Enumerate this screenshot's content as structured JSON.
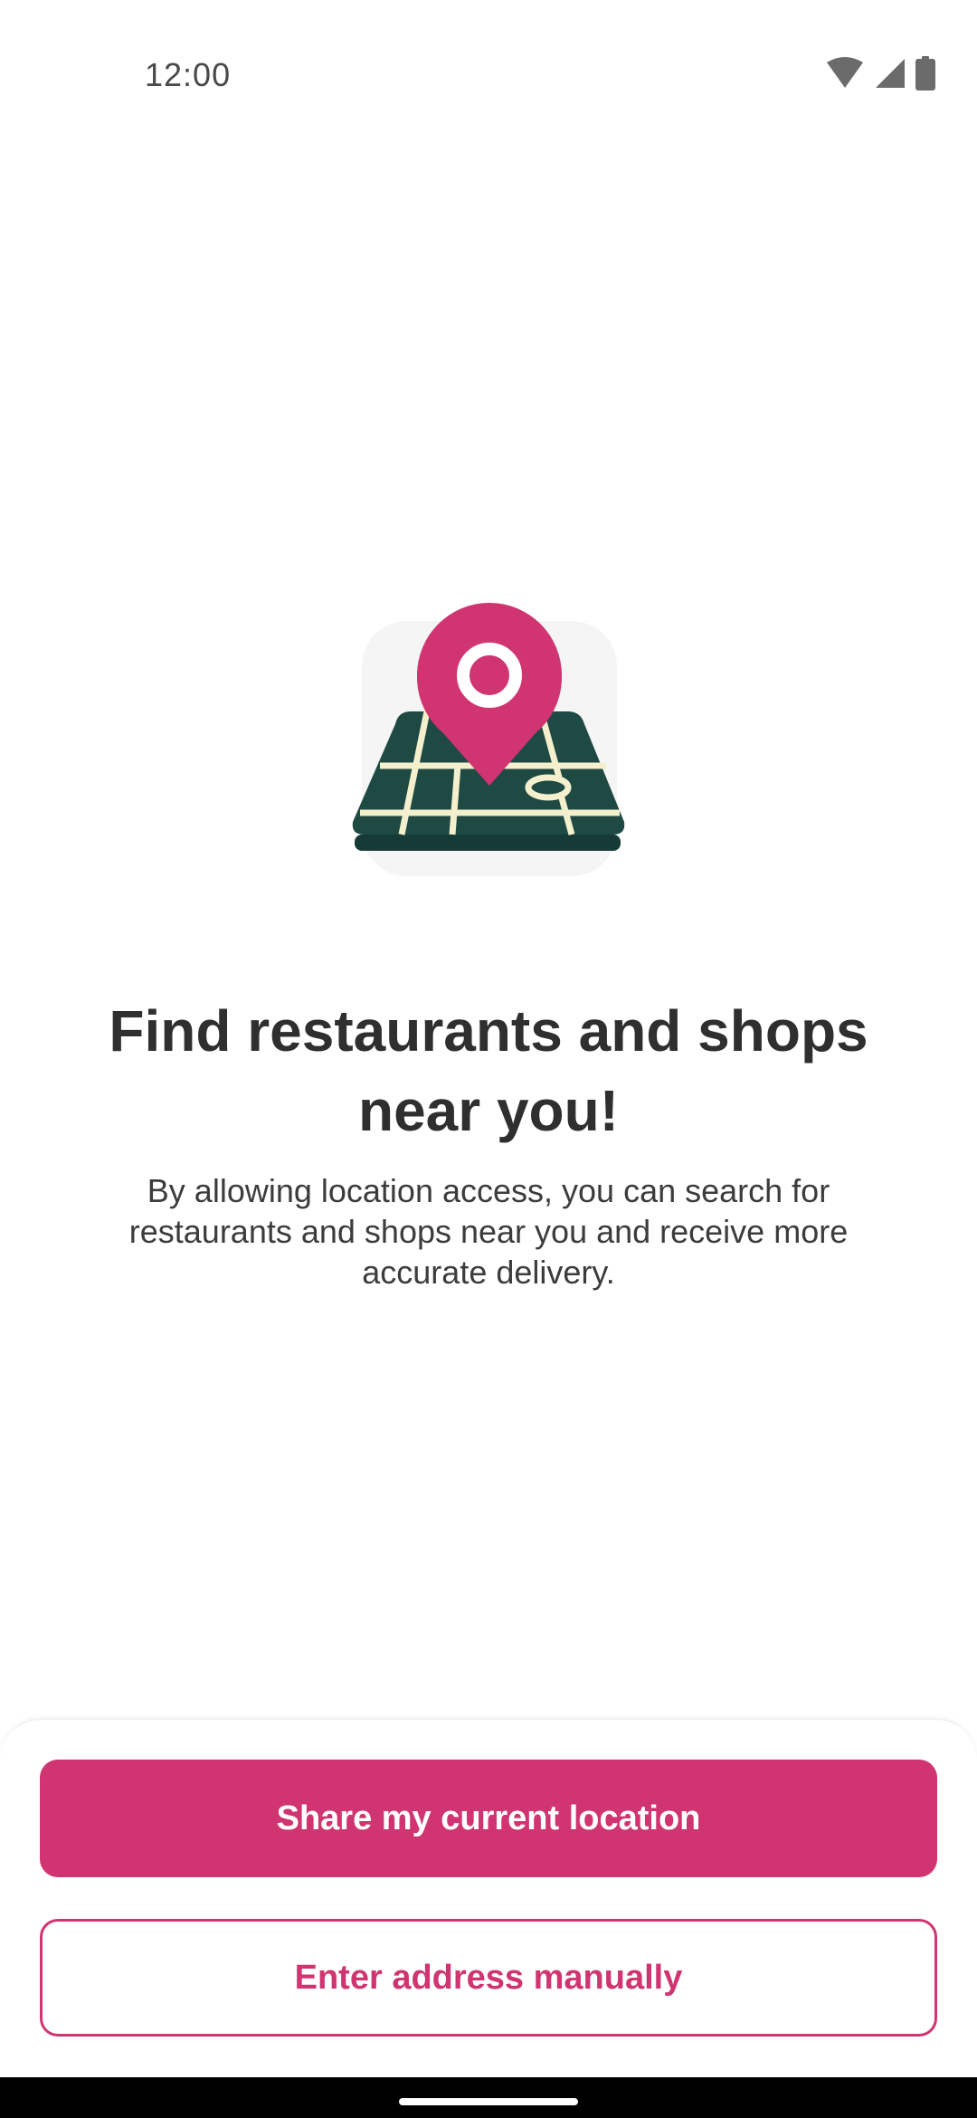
{
  "status_bar": {
    "time": "12:00",
    "icons": [
      "wifi-icon",
      "cellular-signal-icon",
      "battery-icon"
    ]
  },
  "hero": {
    "icon": "map-location-pin-icon",
    "colors": {
      "pin": "#d03571",
      "map": "#1f4a44",
      "roads": "#f4efcd",
      "tile": "#f5f5f5"
    }
  },
  "content": {
    "headline_line1": "Find restaurants and shops",
    "headline_line2": "near you!",
    "body_line1": "By allowing location access, you can search for",
    "body_line2": "restaurants and shops near you and receive more",
    "body_line3": "accurate delivery."
  },
  "actions": {
    "primary_label": "Share my current location",
    "secondary_label": "Enter address manually",
    "accent_color": "#d03571"
  }
}
